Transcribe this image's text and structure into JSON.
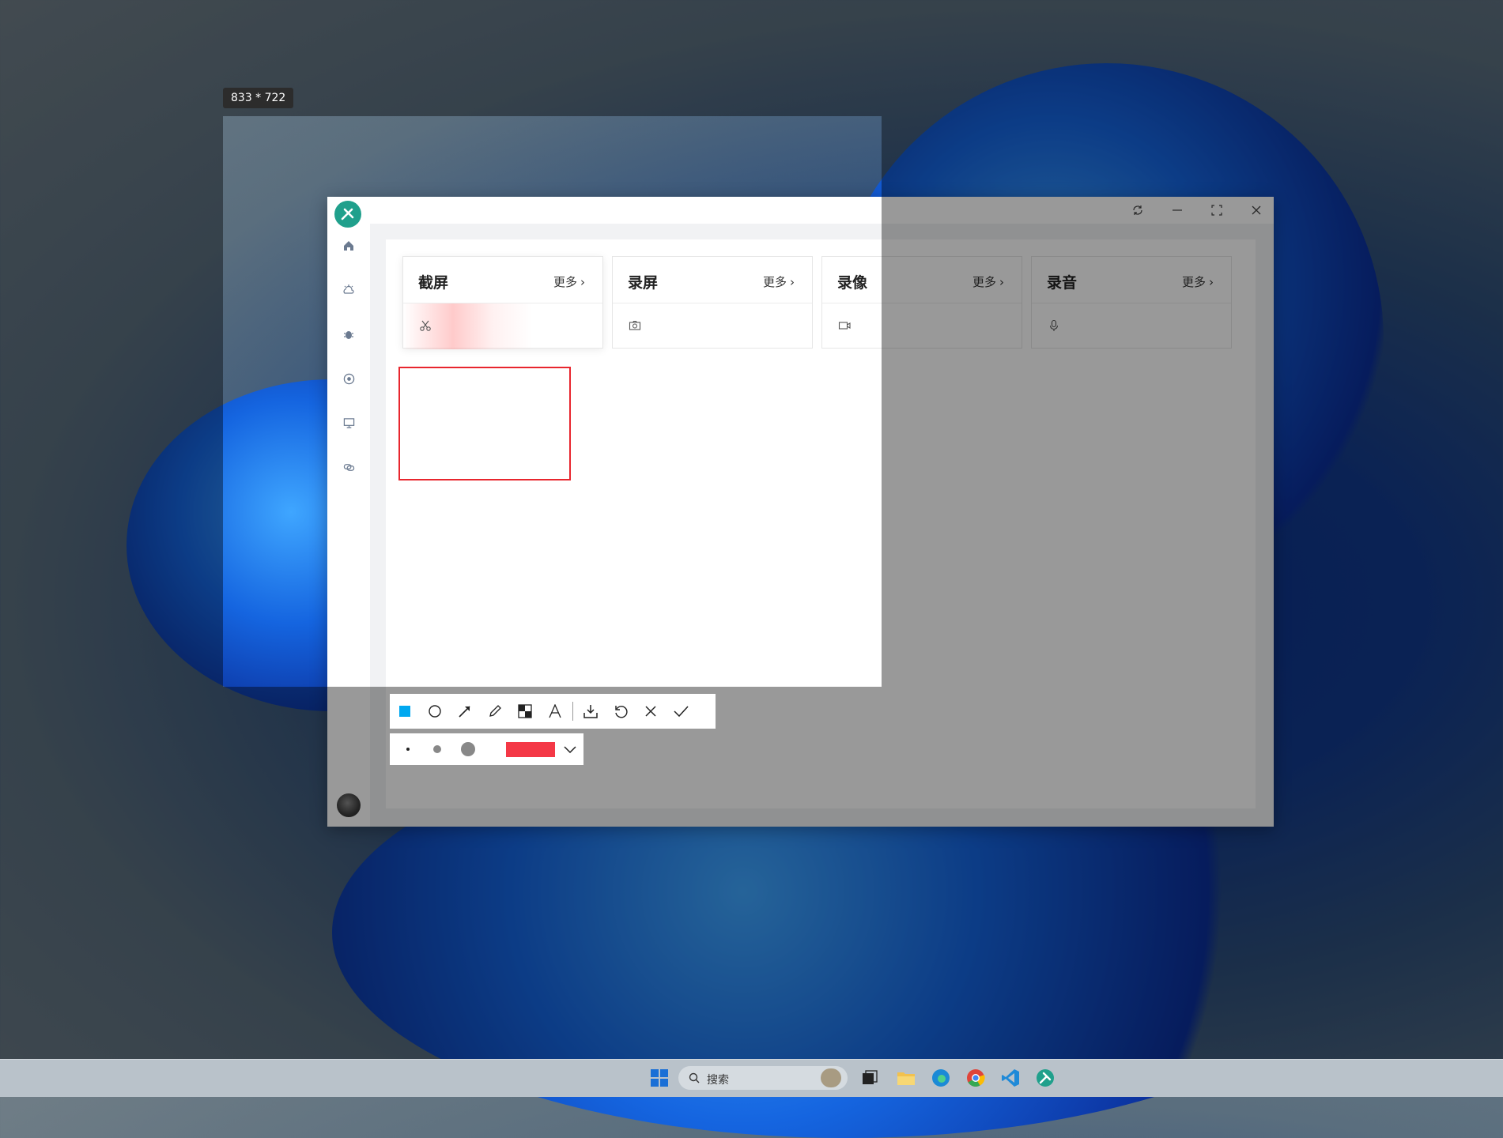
{
  "selection": {
    "size_label": "833 * 722"
  },
  "app": {
    "window_buttons": [
      "refresh-icon",
      "minimize-icon",
      "fullscreen-icon",
      "close-icon"
    ],
    "sidebar_icons": [
      "home-icon",
      "weather-icon",
      "bug-icon",
      "chrome-icon",
      "monitor-icon",
      "link-icon"
    ],
    "cards": [
      {
        "title": "截屏",
        "more": "更多",
        "icon": "scissors-icon"
      },
      {
        "title": "录屏",
        "more": "更多",
        "icon": "camera-icon"
      },
      {
        "title": "录像",
        "more": "更多",
        "icon": "video-icon"
      },
      {
        "title": "录音",
        "more": "更多",
        "icon": "microphone-icon"
      }
    ]
  },
  "annotation_toolbar": {
    "tools": [
      "rectangle-icon",
      "ellipse-icon",
      "arrow-icon",
      "pencil-icon",
      "mosaic-icon",
      "text-icon",
      "download-icon",
      "undo-icon",
      "cancel-icon",
      "confirm-icon"
    ],
    "active_tool": "rectangle-icon",
    "active_color": "#00a8f0",
    "stroke_sizes": [
      "small",
      "medium",
      "large"
    ],
    "selected_color": "#f43846"
  },
  "taskbar": {
    "search_placeholder": "搜索"
  }
}
